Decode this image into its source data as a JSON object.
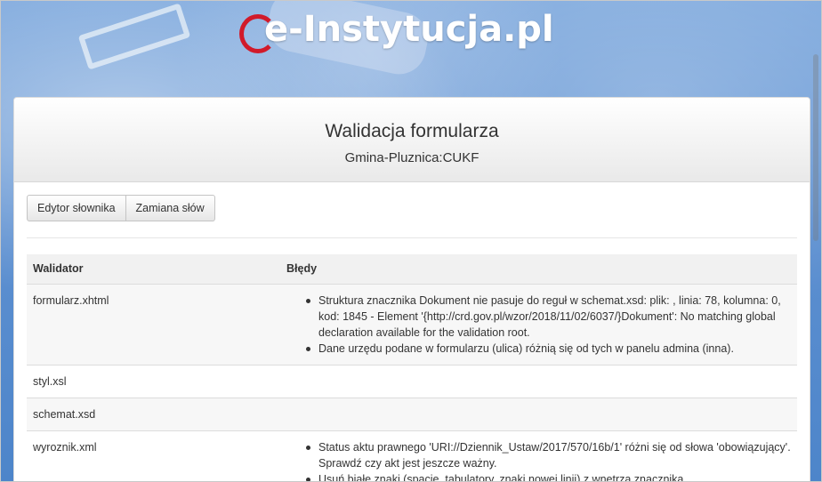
{
  "header": {
    "logo_text": "e-Instytucja.pl"
  },
  "panel": {
    "title": "Walidacja formularza",
    "subtitle": "Gmina-Pluznica:CUKF"
  },
  "toolbar": {
    "dictionary_editor_label": "Edytor słownika",
    "word_replace_label": "Zamiana słów"
  },
  "table": {
    "columns": [
      "Walidator",
      "Błędy"
    ],
    "rows": [
      {
        "validator": "formularz.xhtml",
        "errors": [
          "Struktura znacznika Dokument nie pasuje do reguł w schemat.xsd: plik: , linia: 78, kolumna: 0, kod: 1845 - Element '{http://crd.gov.pl/wzor/2018/11/02/6037/}Dokument': No matching global declaration available for the validation root.",
          "Dane urzędu podane w formularzu (ulica) różnią się od tych w panelu admina (inna)."
        ]
      },
      {
        "validator": "styl.xsl",
        "errors": []
      },
      {
        "validator": "schemat.xsd",
        "errors": []
      },
      {
        "validator": "wyroznik.xml",
        "errors": [
          "Status aktu prawnego 'URI://Dziennik_Ustaw/2017/570/16b/1' różni się od słowa 'obowiązujący'. Sprawdź czy akt jest jeszcze ważny.",
          "Usuń białe znaki (spacje, tabulatory, znaki nowej linii) z wnętrza znacznika"
        ]
      }
    ]
  }
}
